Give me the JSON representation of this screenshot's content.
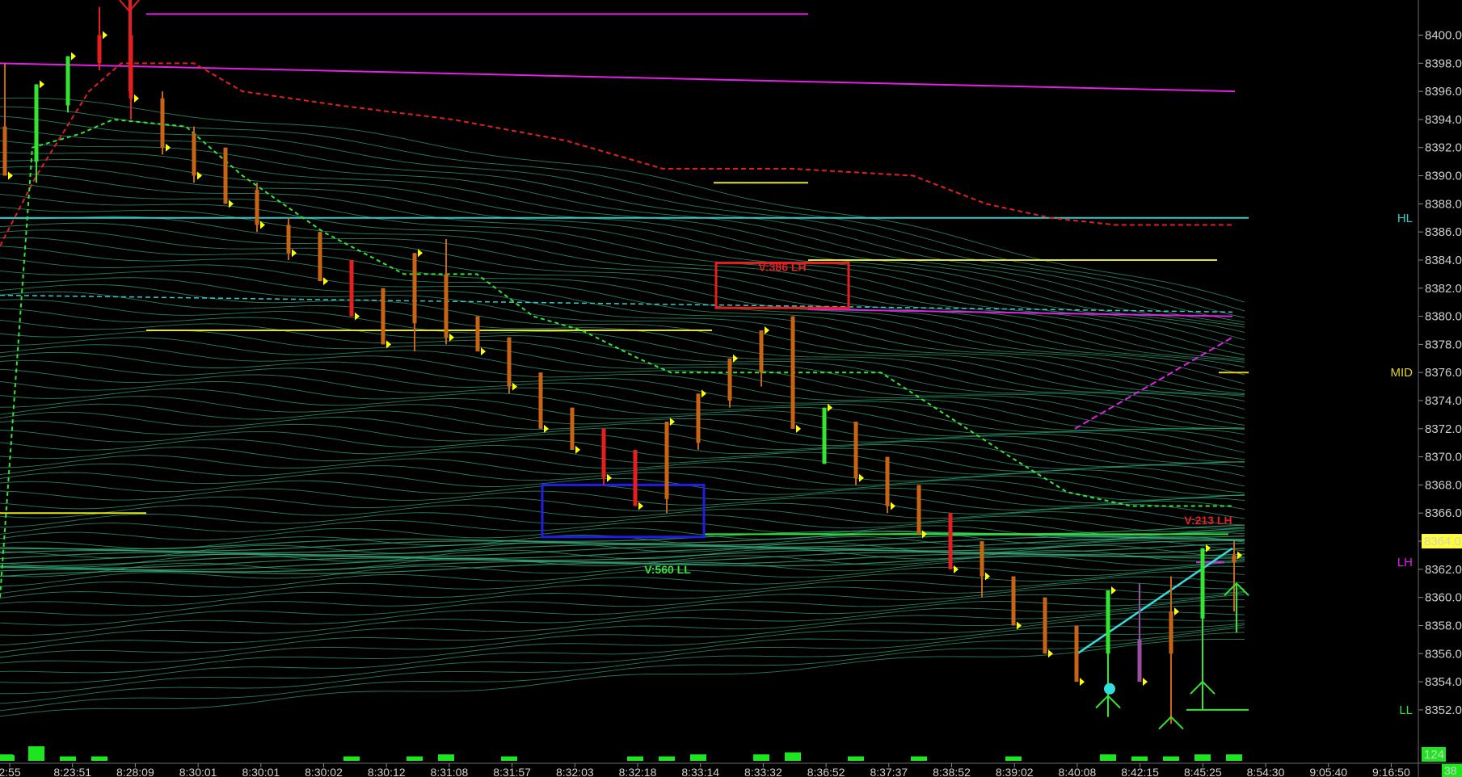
{
  "chart_data": {
    "type": "candlestick",
    "ylim": [
      8350.5,
      8402.5
    ],
    "price_ticks": [
      "8400.0",
      "8398.0",
      "8396.0",
      "8394.0",
      "8392.0",
      "8390.0",
      "8388.0",
      "8386.0",
      "8384.0",
      "8382.0",
      "8380.0",
      "8378.0",
      "8376.0",
      "8374.0",
      "8372.0",
      "8370.0",
      "8368.0",
      "8366.0",
      "8364.0",
      "8362.0",
      "8360.0",
      "8358.0",
      "8356.0",
      "8354.0",
      "8352.0"
    ],
    "time_ticks": [
      "2:55",
      "8:23:51",
      "8:28:09",
      "8:30:01",
      "8:30:01",
      "8:30:02",
      "8:30:12",
      "8:31:08",
      "8:31:57",
      "8:32:03",
      "8:32:18",
      "8:33:14",
      "8:33:32",
      "8:36:52",
      "8:37:37",
      "8:38:52",
      "8:39:02",
      "8:40:08",
      "8:42:15",
      "8:45:25",
      "8:54:30",
      "9:05:40",
      "9:16:50"
    ],
    "current_price": "8364.0",
    "volume_readout": "124",
    "corner_readout": "38",
    "bars": [
      {
        "o": 8393.5,
        "h": 8398.0,
        "l": 8390.0,
        "c": 8390.0,
        "color": "#c86414"
      },
      {
        "o": 8391.0,
        "h": 8396.5,
        "l": 8389.5,
        "c": 8396.5,
        "color": "#32e632"
      },
      {
        "o": 8395.0,
        "h": 8398.5,
        "l": 8394.5,
        "c": 8398.5,
        "color": "#32e632"
      },
      {
        "o": 8398.0,
        "h": 8402.0,
        "l": 8397.5,
        "c": 8400.0,
        "color": "#e61e1e"
      },
      {
        "o": 8400.0,
        "h": 8402.5,
        "l": 8394.0,
        "c": 8395.5,
        "color": "#e61e1e"
      },
      {
        "o": 8395.5,
        "h": 8396.0,
        "l": 8391.5,
        "c": 8392.0,
        "color": "#c86414"
      },
      {
        "o": 8393.0,
        "h": 8393.5,
        "l": 8389.5,
        "c": 8390.0,
        "color": "#c86414"
      },
      {
        "o": 8392.0,
        "h": 8392.0,
        "l": 8388.0,
        "c": 8388.0,
        "color": "#c86414"
      },
      {
        "o": 8389.0,
        "h": 8389.5,
        "l": 8386.0,
        "c": 8386.5,
        "color": "#c86414"
      },
      {
        "o": 8386.5,
        "h": 8387.0,
        "l": 8384.0,
        "c": 8384.5,
        "color": "#c86414"
      },
      {
        "o": 8386.0,
        "h": 8386.0,
        "l": 8382.5,
        "c": 8382.5,
        "color": "#c86414"
      },
      {
        "o": 8384.0,
        "h": 8384.0,
        "l": 8380.0,
        "c": 8380.0,
        "color": "#e61e1e"
      },
      {
        "o": 8382.0,
        "h": 8382.0,
        "l": 8378.0,
        "c": 8378.0,
        "color": "#c86414"
      },
      {
        "o": 8379.5,
        "h": 8384.5,
        "l": 8377.5,
        "c": 8384.5,
        "color": "#c86414"
      },
      {
        "o": 8383.0,
        "h": 8385.5,
        "l": 8378.0,
        "c": 8378.5,
        "color": "#c86414"
      },
      {
        "o": 8380.0,
        "h": 8380.0,
        "l": 8377.5,
        "c": 8377.5,
        "color": "#c86414"
      },
      {
        "o": 8378.5,
        "h": 8378.5,
        "l": 8374.5,
        "c": 8375.0,
        "color": "#c86414"
      },
      {
        "o": 8376.0,
        "h": 8376.0,
        "l": 8372.0,
        "c": 8372.0,
        "color": "#c86414"
      },
      {
        "o": 8373.5,
        "h": 8373.5,
        "l": 8370.5,
        "c": 8370.5,
        "color": "#c86414"
      },
      {
        "o": 8372.0,
        "h": 8372.0,
        "l": 8368.0,
        "c": 8368.5,
        "color": "#e61e1e"
      },
      {
        "o": 8370.5,
        "h": 8370.5,
        "l": 8366.5,
        "c": 8366.5,
        "color": "#e61e1e"
      },
      {
        "o": 8367.0,
        "h": 8372.5,
        "l": 8366.0,
        "c": 8372.5,
        "color": "#c86414"
      },
      {
        "o": 8371.0,
        "h": 8374.5,
        "l": 8370.5,
        "c": 8374.5,
        "color": "#c86414"
      },
      {
        "o": 8374.0,
        "h": 8377.0,
        "l": 8373.5,
        "c": 8377.0,
        "color": "#c86414"
      },
      {
        "o": 8376.0,
        "h": 8379.0,
        "l": 8375.0,
        "c": 8379.0,
        "color": "#c86414"
      },
      {
        "o": 8380.0,
        "h": 8380.0,
        "l": 8372.0,
        "c": 8372.0,
        "color": "#c86414"
      },
      {
        "o": 8369.5,
        "h": 8373.5,
        "l": 8369.5,
        "c": 8373.5,
        "color": "#32e632"
      },
      {
        "o": 8372.5,
        "h": 8372.5,
        "l": 8368.0,
        "c": 8368.5,
        "color": "#c86414"
      },
      {
        "o": 8370.0,
        "h": 8370.0,
        "l": 8366.0,
        "c": 8366.5,
        "color": "#c86414"
      },
      {
        "o": 8368.0,
        "h": 8368.0,
        "l": 8364.5,
        "c": 8364.5,
        "color": "#c86414"
      },
      {
        "o": 8366.0,
        "h": 8366.0,
        "l": 8362.0,
        "c": 8362.0,
        "color": "#e61e1e"
      },
      {
        "o": 8364.0,
        "h": 8364.0,
        "l": 8360.0,
        "c": 8361.5,
        "color": "#c86414"
      },
      {
        "o": 8361.5,
        "h": 8361.5,
        "l": 8358.0,
        "c": 8358.0,
        "color": "#c86414"
      },
      {
        "o": 8360.0,
        "h": 8360.0,
        "l": 8356.0,
        "c": 8356.0,
        "color": "#c86414"
      },
      {
        "o": 8358.0,
        "h": 8358.0,
        "l": 8354.0,
        "c": 8354.0,
        "color": "#c86414"
      },
      {
        "o": 8356.0,
        "h": 8360.5,
        "l": 8351.5,
        "c": 8360.5,
        "color": "#32e632"
      },
      {
        "o": 8357.0,
        "h": 8361.0,
        "l": 8354.0,
        "c": 8354.0,
        "color": "#9a4fa0"
      },
      {
        "o": 8356.0,
        "h": 8361.5,
        "l": 8351.0,
        "c": 8359.0,
        "color": "#c86414"
      },
      {
        "o": 8358.5,
        "h": 8363.5,
        "l": 8352.0,
        "c": 8363.5,
        "color": "#32e632"
      },
      {
        "o": 8362.5,
        "h": 8364.0,
        "l": 8359.0,
        "c": 8363.0,
        "color": "#c86414"
      }
    ],
    "levels": [
      {
        "name": "HL",
        "price": 8387.0,
        "color": "#33cccc"
      },
      {
        "name": "MID",
        "price": 8376.0,
        "color": "#e6d21e"
      },
      {
        "name": "LH",
        "price": 8362.5,
        "color": "#e61ee6"
      },
      {
        "name": "LL",
        "price": 8352.0,
        "color": "#32e632"
      }
    ],
    "annotations": [
      {
        "text": "V:386 LH",
        "price": 8383.5,
        "color": "#e62020"
      },
      {
        "text": "V:560 LL",
        "price": 8362.0,
        "color": "#32e632"
      },
      {
        "text": "V:213 LH",
        "price": 8365.5,
        "color": "#e62020"
      }
    ],
    "volume": [
      2,
      6,
      1,
      1,
      0,
      0,
      0,
      0,
      0,
      0,
      0,
      1,
      0,
      1,
      2,
      0,
      1,
      0,
      0,
      0,
      1,
      1,
      2,
      0,
      2,
      3,
      0,
      1,
      0,
      1,
      0,
      0,
      1,
      0,
      0,
      2,
      1,
      1,
      2,
      2
    ]
  }
}
